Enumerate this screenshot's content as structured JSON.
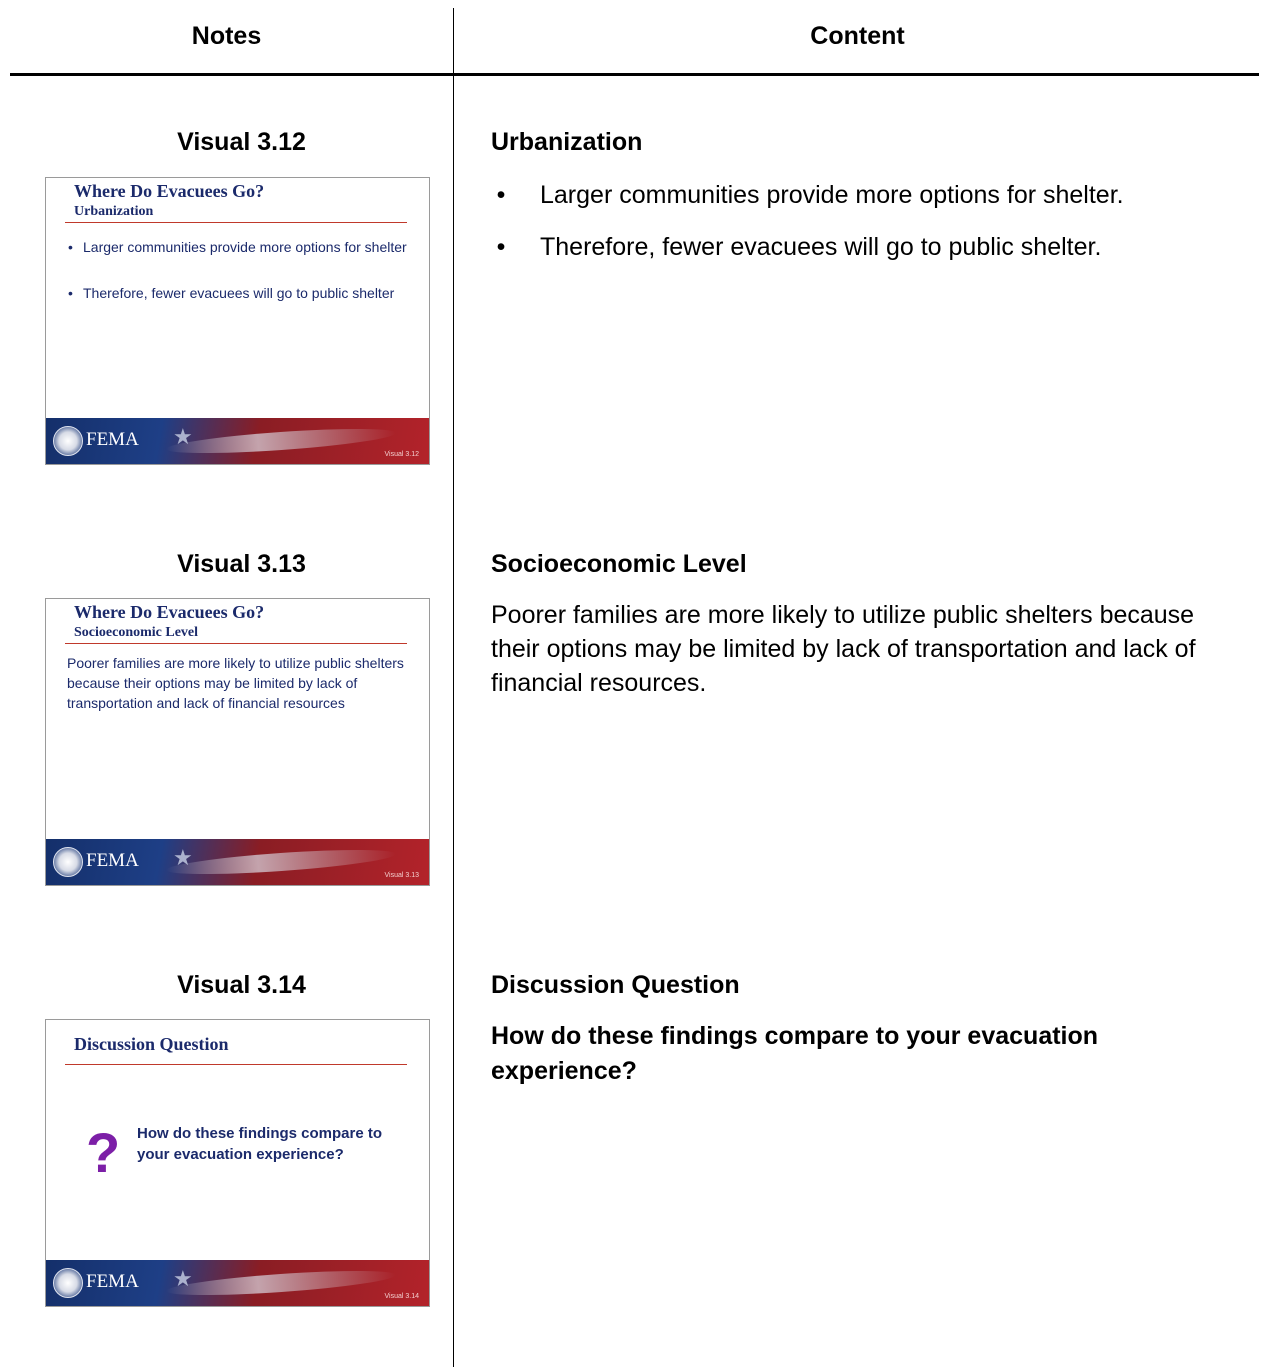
{
  "header": {
    "notes": "Notes",
    "content": "Content"
  },
  "rows": [
    {
      "visual_label": "Visual 3.12",
      "slide": {
        "title": "Where Do Evacuees Go?",
        "subtitle": "Urbanization",
        "bullets": [
          "Larger communities provide more options for shelter",
          "Therefore, fewer evacuees will go to public shelter"
        ],
        "footer_brand": "FEMA",
        "footer_visual": "Visual 3.12"
      },
      "section_title": "Urbanization",
      "bullets": [
        "Larger communities provide more options for shelter.",
        "Therefore, fewer evacuees will go to public shelter."
      ]
    },
    {
      "visual_label": "Visual 3.13",
      "slide": {
        "title": "Where Do Evacuees Go?",
        "subtitle": "Socioeconomic Level",
        "body": "Poorer families are more likely to utilize public shelters because their options may be limited by lack of transportation and lack of financial resources",
        "footer_brand": "FEMA",
        "footer_visual": "Visual 3.13"
      },
      "section_title": "Socioeconomic Level",
      "body": "Poorer families are more likely to utilize public shelters because their options may be limited by lack of transportation and lack of financial resources."
    },
    {
      "visual_label": "Visual 3.14",
      "slide": {
        "title": "Discussion Question",
        "question_mark": "?",
        "body": "How do these findings compare to your evacuation experience?",
        "footer_brand": "FEMA",
        "footer_visual": "Visual 3.14"
      },
      "section_title": "Discussion Question",
      "question": "How do these findings compare to your evacuation experience?"
    }
  ]
}
